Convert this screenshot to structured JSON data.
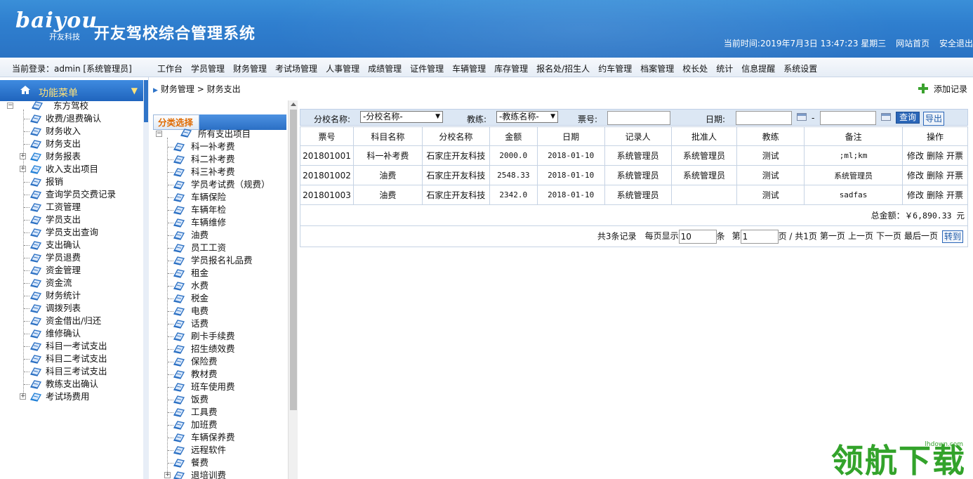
{
  "header": {
    "logo_word": "baiyou",
    "logo_sub": "开友科技",
    "title": "开友驾校综合管理系统",
    "time_label": "当前时间:",
    "time_value": "2019年7月3日 13:47:23 星期三",
    "home_link": "网站首页",
    "logout_link": "安全退出"
  },
  "menubar": {
    "login_info": "当前登录：admin [系统管理员]",
    "items": [
      "工作台",
      "学员管理",
      "财务管理",
      "考试场管理",
      "人事管理",
      "成绩管理",
      "证件管理",
      "车辆管理",
      "库存管理",
      "报名处/招生人",
      "约车管理",
      "档案管理",
      "校长处",
      "统计",
      "信息提醒",
      "系统设置"
    ]
  },
  "sidebar": {
    "title": "功能菜单",
    "root": "东方驾校",
    "items": [
      {
        "label": "收费/退费确认",
        "expand": false
      },
      {
        "label": "财务收入",
        "expand": false
      },
      {
        "label": "财务支出",
        "expand": false
      },
      {
        "label": "财务报表",
        "expand": true
      },
      {
        "label": "收入支出项目",
        "expand": true
      },
      {
        "label": "报销",
        "expand": false
      },
      {
        "label": "查询学员交费记录",
        "expand": false
      },
      {
        "label": "工资管理",
        "expand": false
      },
      {
        "label": "学员支出",
        "expand": false
      },
      {
        "label": "学员支出查询",
        "expand": false
      },
      {
        "label": "支出确认",
        "expand": false
      },
      {
        "label": "学员退费",
        "expand": false
      },
      {
        "label": "资金管理",
        "expand": false
      },
      {
        "label": "资金流",
        "expand": false
      },
      {
        "label": "财务统计",
        "expand": false
      },
      {
        "label": "调拨列表",
        "expand": false
      },
      {
        "label": "资金借出/归还",
        "expand": false
      },
      {
        "label": "维修确认",
        "expand": false
      },
      {
        "label": "科目一考试支出",
        "expand": false
      },
      {
        "label": "科目二考试支出",
        "expand": false
      },
      {
        "label": "科目三考试支出",
        "expand": false
      },
      {
        "label": "教练支出确认",
        "expand": false
      },
      {
        "label": "考试场费用",
        "expand": true
      }
    ]
  },
  "breadcrumb": "财务管理 > 财务支出",
  "add_record": "添加记录",
  "category": {
    "title": "分类选择",
    "root": "所有支出项目",
    "items": [
      "科一补考费",
      "科二补考费",
      "科三补考费",
      "学员考试费（规费）",
      "车辆保险",
      "车辆年检",
      "车辆维修",
      "油费",
      "员工工资",
      "学员报名礼品费",
      "租金",
      "水费",
      "税金",
      "电费",
      "话费",
      "刷卡手续费",
      "招生绩效费",
      "保险费",
      "教材费",
      "班车使用费",
      "饭费",
      "工具费",
      "加班费",
      "车辆保养费",
      "远程软件",
      "餐费",
      "退培训费"
    ]
  },
  "filter": {
    "school_label": "分校名称:",
    "school_value": "-分校名称-",
    "coach_label": "教练:",
    "coach_value": "-教练名称-",
    "ticket_label": "票号:",
    "date_label": "日期:",
    "dash": "-",
    "search_btn": "查询",
    "export_btn": "导出"
  },
  "table": {
    "headers": [
      "票号",
      "科目名称",
      "分校名称",
      "金额",
      "日期",
      "记录人",
      "批准人",
      "教练",
      "备注",
      "操作"
    ],
    "rows": [
      {
        "ticket": "201801001",
        "subject": "科一补考费",
        "school": "石家庄开友科技",
        "amount": "2000.0",
        "date": "2018-01-10",
        "recorder": "系统管理员",
        "approver": "系统管理员",
        "coach": "测试",
        "note": ";ml;km"
      },
      {
        "ticket": "201801002",
        "subject": "油费",
        "school": "石家庄开友科技",
        "amount": "2548.33",
        "date": "2018-01-10",
        "recorder": "系统管理员",
        "approver": "系统管理员",
        "coach": "测试",
        "note": "系统管理员"
      },
      {
        "ticket": "201801003",
        "subject": "油费",
        "school": "石家庄开友科技",
        "amount": "2342.0",
        "date": "2018-01-10",
        "recorder": "系统管理员",
        "approver": "",
        "coach": "测试",
        "note": "sadfas"
      }
    ],
    "op_edit": "修改",
    "op_delete": "删除",
    "op_invoice": "开票",
    "total_label": "总金额：",
    "total_value": "￥6,890.33 元"
  },
  "pager": {
    "count_text": "共3条记录",
    "per_page_label": "每页显示",
    "per_page_value": "10",
    "per_page_unit": "条",
    "page_label": "第",
    "page_value": "1",
    "page_total": "页 / 共1页",
    "first": "第一页",
    "prev": "上一页",
    "next": "下一页",
    "last": "最后一页",
    "go": "转到"
  },
  "watermark": {
    "text": "领航下载",
    "sub": "lhdown.com"
  }
}
